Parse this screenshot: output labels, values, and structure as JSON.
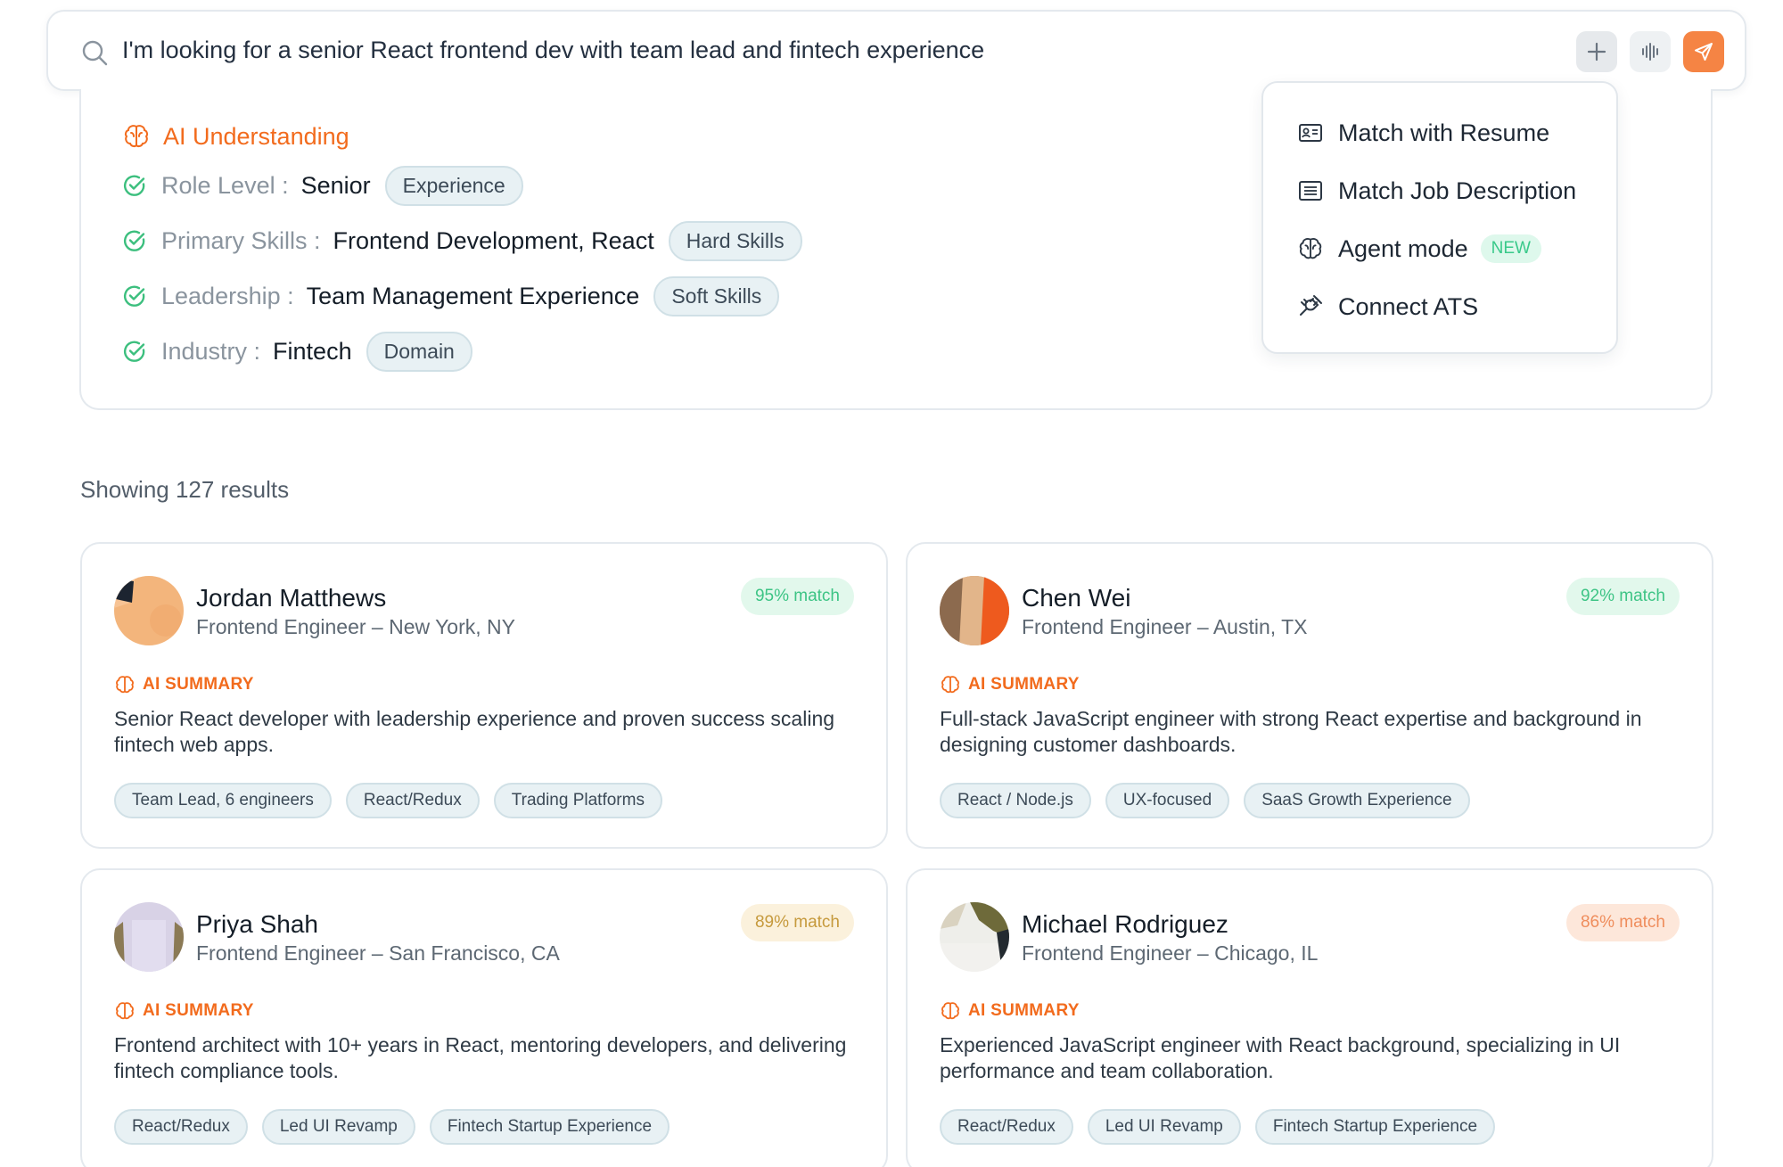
{
  "search": {
    "query": "I'm looking for a senior React frontend dev with team lead and fintech experience"
  },
  "ai_understanding": {
    "title": "AI Understanding",
    "criteria": [
      {
        "label": "Role Level :",
        "value": "Senior",
        "tag": "Experience"
      },
      {
        "label": "Primary Skills :",
        "value": "Frontend Development, React",
        "tag": "Hard Skills"
      },
      {
        "label": "Leadership :",
        "value": "Team Management Experience",
        "tag": "Soft Skills"
      },
      {
        "label": "Industry :",
        "value": "Fintech",
        "tag": "Domain"
      }
    ]
  },
  "menu": {
    "items": [
      {
        "label": "Match with Resume",
        "icon": "id-card-icon"
      },
      {
        "label": "Match Job Description",
        "icon": "document-lines-icon"
      },
      {
        "label": "Agent mode",
        "icon": "brain-icon",
        "badge": "NEW"
      },
      {
        "label": "Connect ATS",
        "icon": "plug-icon"
      }
    ]
  },
  "results": {
    "count_text": "Showing 127 results",
    "summary_label": "AI SUMMARY",
    "candidates": [
      {
        "name": "Jordan Matthews",
        "role": "Frontend Engineer – New York, NY",
        "match": "95% match",
        "match_color": "#3dc485",
        "summary": "Senior React developer with leadership experience and proven success scaling fintech web apps.",
        "tags": [
          "Team Lead, 6 engineers",
          "React/Redux",
          "Trading Platforms"
        ]
      },
      {
        "name": "Chen Wei",
        "role": "Frontend Engineer – Austin, TX",
        "match": "92% match",
        "match_color": "#3dc485",
        "summary": "Full-stack JavaScript engineer with strong React expertise and background in designing customer dashboards.",
        "tags": [
          "React / Node.js",
          "UX-focused",
          "SaaS Growth Experience"
        ]
      },
      {
        "name": "Priya Shah",
        "role": "Frontend Engineer – San Francisco, CA",
        "match": "89% match",
        "match_color": "#c69a3d",
        "summary": "Frontend architect with 10+ years in React, mentoring developers, and delivering fintech compliance tools.",
        "tags": [
          "React/Redux",
          "Led UI Revamp",
          "Fintech Startup Experience"
        ]
      },
      {
        "name": "Michael Rodriguez",
        "role": "Frontend Engineer – Chicago, IL",
        "match": "86% match",
        "match_color": "#ef8d5c",
        "summary": "Experienced JavaScript engineer with React background, specializing in UI performance and team collaboration.",
        "tags": [
          "React/Redux",
          "Led UI Revamp",
          "Fintech Startup Experience"
        ]
      }
    ]
  },
  "colors": {
    "accent_orange": "#f26b1d",
    "send_button": "#f58444",
    "check_green": "#3cbf7e"
  }
}
